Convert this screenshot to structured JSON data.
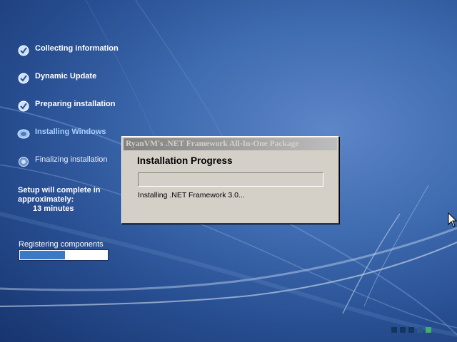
{
  "sidebar": {
    "steps": [
      {
        "label": "Collecting information",
        "state": "completed",
        "icon": "checkmark-bullet-icon"
      },
      {
        "label": "Dynamic Update",
        "state": "completed",
        "icon": "checkmark-bullet-icon"
      },
      {
        "label": "Preparing installation",
        "state": "completed",
        "icon": "checkmark-bullet-icon"
      },
      {
        "label": "Installing Windows",
        "state": "current",
        "icon": "active-bullet-icon"
      },
      {
        "label": "Finalizing installation",
        "state": "pending",
        "icon": "pending-bullet-icon"
      }
    ],
    "time_remaining": {
      "line1": "Setup will complete in",
      "line2": "approximately:",
      "minutes": "13 minutes"
    },
    "status": {
      "label": "Registering components",
      "progress": 0.52
    }
  },
  "dialog": {
    "title": "RyanVM's .NET Framework All-In-One Package",
    "heading": "Installation Progress",
    "progress": 0,
    "status": "Installing .NET Framework 3.0..."
  },
  "activity_indicator": {
    "squares": 5,
    "lit_index": 4
  },
  "colors": {
    "desktop_blue": "#3f6bb0",
    "current_step_text": "#a8d0ff",
    "status_bar_fill": "#3979c6",
    "dialog_face": "#d4d0c8",
    "activity_lit": "#3fb06a"
  }
}
